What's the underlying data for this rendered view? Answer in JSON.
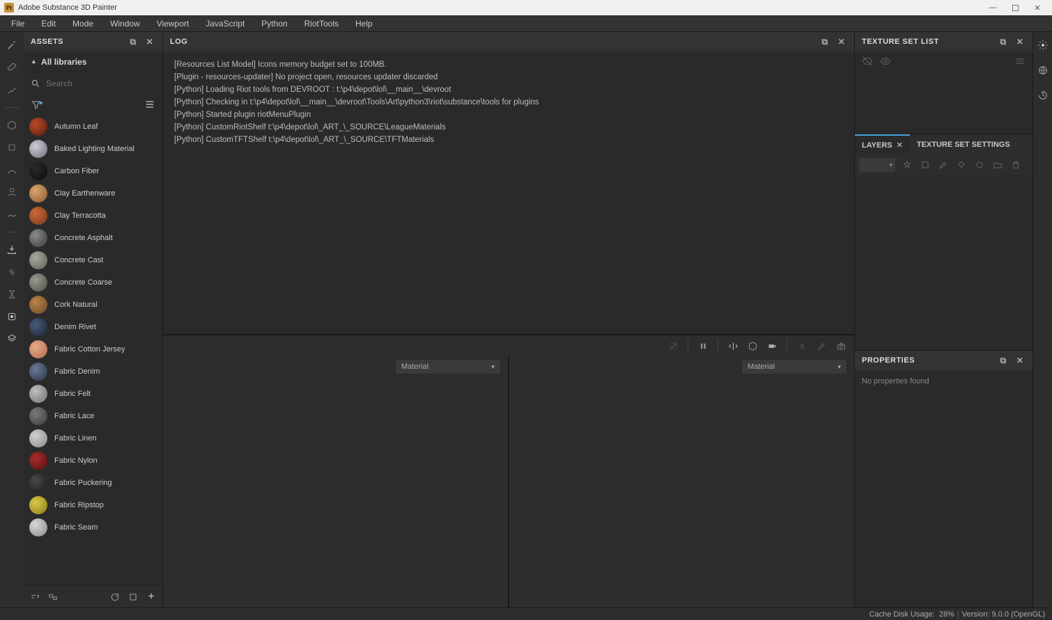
{
  "app": {
    "title": "Adobe Substance 3D Painter"
  },
  "menu": [
    "File",
    "Edit",
    "Mode",
    "Window",
    "Viewport",
    "JavaScript",
    "Python",
    "RiotTools",
    "Help"
  ],
  "assets": {
    "panel_title": "ASSETS",
    "libraries_label": "All libraries",
    "search_placeholder": "Search",
    "items": [
      {
        "name": "Autumn Leaf",
        "color": "radial-gradient(circle at 35% 35%, #b84a2a, #5a1c0c)"
      },
      {
        "name": "Baked Lighting Material",
        "color": "radial-gradient(circle at 35% 35%, #cfcfd6, #6a6a78)"
      },
      {
        "name": "Carbon Fiber",
        "color": "radial-gradient(circle at 35% 35%, #2b2b2b, #0a0a0a)"
      },
      {
        "name": "Clay Earthenware",
        "color": "radial-gradient(circle at 35% 35%, #d9a470, #8a5a30)"
      },
      {
        "name": "Clay Terracotta",
        "color": "radial-gradient(circle at 35% 35%, #c96a3a, #7a371a)"
      },
      {
        "name": "Concrete Asphalt",
        "color": "radial-gradient(circle at 35% 35%, #8a8a8a, #3a3a3a)"
      },
      {
        "name": "Concrete Cast",
        "color": "radial-gradient(circle at 35% 35%, #a8a89e, #5f5f58)"
      },
      {
        "name": "Concrete Coarse",
        "color": "radial-gradient(circle at 35% 35%, #9a9a92, #4e4e48)"
      },
      {
        "name": "Cork Natural",
        "color": "radial-gradient(circle at 35% 35%, #b8844a, #6b4826)"
      },
      {
        "name": "Denim Rivet",
        "color": "radial-gradient(circle at 35% 35%, #4a5a78, #1b2438)"
      },
      {
        "name": "Fabric Cotton Jersey",
        "color": "radial-gradient(circle at 35% 35%, #e8a988, #b06a50)"
      },
      {
        "name": "Fabric Denim",
        "color": "radial-gradient(circle at 35% 35%, #6a7a98, #2a3448)"
      },
      {
        "name": "Fabric Felt",
        "color": "radial-gradient(circle at 35% 35%, #bfbfbf, #707070)"
      },
      {
        "name": "Fabric Lace",
        "color": "radial-gradient(circle at 35% 35%, #7a7a7a, #3a3a3a)"
      },
      {
        "name": "Fabric Linen",
        "color": "radial-gradient(circle at 35% 35%, #d0d0d0, #888888)"
      },
      {
        "name": "Fabric Nylon",
        "color": "radial-gradient(circle at 35% 35%, #a82c2c, #5a0f0f)"
      },
      {
        "name": "Fabric Puckering",
        "color": "radial-gradient(circle at 35% 35%, #4a4a4a, #1a1a1a)"
      },
      {
        "name": "Fabric Ripstop",
        "color": "radial-gradient(circle at 35% 35%, #d8c848, #8a7c1a)"
      },
      {
        "name": "Fabric Seam",
        "color": "radial-gradient(circle at 35% 35%, #d8d8d8, #888888)"
      }
    ]
  },
  "log": {
    "panel_title": "LOG",
    "lines": [
      "[Resources List Model] Icons memory budget set to 100MB.",
      "[Plugin - resources-updater] No project open, resources updater discarded",
      "[Python] Loading Riot tools from DEVROOT : t:\\p4\\depot\\lol\\__main__\\devroot",
      "[Python] Checking in t:\\p4\\depot\\lol\\__main__\\devroot\\Tools\\Art\\python3\\riot\\substance\\tools for plugins",
      "[Python] Started plugin riotMenuPlugin",
      "[Python] CustomRiotShelf t:\\p4\\depot\\lol\\_ART_\\_SOURCE\\LeagueMaterials",
      "[Python] CustomTFTShelf t:\\p4\\depot\\lol\\_ART_\\_SOURCE\\TFTMaterials"
    ]
  },
  "viewport": {
    "material_label": "Material"
  },
  "texset": {
    "panel_title": "TEXTURE SET LIST"
  },
  "tabs": {
    "layers": "LAYERS",
    "texset_settings": "TEXTURE SET SETTINGS"
  },
  "properties": {
    "panel_title": "PROPERTIES",
    "empty": "No properties found"
  },
  "status": {
    "cache_label": "Cache Disk Usage:",
    "cache_value": "28%",
    "version_label": "Version:",
    "version_value": "9.0.0 (OpenGL)"
  }
}
